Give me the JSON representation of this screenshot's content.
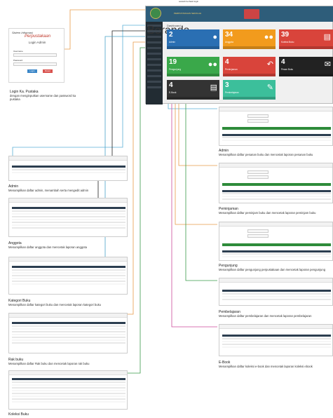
{
  "header_note": "setelah berhasil login",
  "login": {
    "brand_line1": "Sistem Informasi",
    "brand_line2": "Perpustakaan",
    "title": "Login Admin",
    "username_label": "Username",
    "password_label": "Password",
    "login_button": "Login",
    "reset_button": "Reset",
    "caption_title": "Login Ka. Pustaka",
    "caption_desc": "dengan menginputkan username dan password ka pustaka"
  },
  "dashboard": {
    "heading": "Dashboard",
    "app_title": "PERPUSTAKAAN SEKOLAH",
    "side_items": [
      "Beranda",
      "Admin",
      "Anggota",
      "Kategori Buku",
      "Rak Buku",
      "Koleksi Buku",
      "Eksemplar",
      "E-Book",
      "Peminjaman",
      "Pengunjung",
      "Pemesanan",
      "Pembelajaran"
    ],
    "tiles": [
      {
        "value": "2",
        "label": "Admin",
        "color": "#2a6fb3",
        "icon": "user-icon"
      },
      {
        "value": "34",
        "label": "Anggota",
        "color": "#f29b1d",
        "icon": "users-icon"
      },
      {
        "value": "39",
        "label": "Koleksi Buku",
        "color": "#d9443b",
        "icon": "book-icon"
      },
      {
        "value": "19",
        "label": "Pengunjung",
        "color": "#3aa84a",
        "icon": "group-icon"
      },
      {
        "value": "4",
        "label": "Peminjaman",
        "color": "#d9443b",
        "icon": "reply-icon"
      },
      {
        "value": "4",
        "label": "Pesan Buku",
        "color": "#222222",
        "icon": "mail-icon"
      },
      {
        "value": "4",
        "label": "E-Book",
        "color": "#333333",
        "icon": "pdf-icon"
      },
      {
        "value": "3",
        "label": "Pembelajaran",
        "color": "#3cbf9b",
        "icon": "pencil-icon"
      }
    ]
  },
  "captions": {
    "admin": {
      "title": "Admin",
      "desc": "Menampilkan daftar admin, menambah serta mengedit admin"
    },
    "anggota": {
      "title": "Anggota",
      "desc": "Menampilkan daftar anggota dan mencetak laporan anggota"
    },
    "kategori": {
      "title": "Kategori Buku",
      "desc": "Menampilkan daftar kategori buku dan mencetak laporan kategori buku"
    },
    "rak": {
      "title": "Rak buku",
      "desc": "Menampilkan daftar Rak buku dan mencetak laporan rak buku"
    },
    "koleksi": {
      "title": "Koleksi Buku",
      "desc": ""
    },
    "pesan": {
      "title": "Admin",
      "desc": "Menampilkan daftar pesanan buku dan mencetak laporan pesanan buku"
    },
    "pinjam": {
      "title": "Peminjaman",
      "desc": "Menampilkan daftar peminjam buku dan mencetak laporan peminjam buku"
    },
    "pengunjung": {
      "title": "Pengunjung",
      "desc": "Menampilkan daftar pengunjung perpustakaan dan mencetak laporan pengunjung"
    },
    "belajar": {
      "title": "Pembelajaran",
      "desc": "Menampilkan daftar pembelajaran dan mencetak laporan pembelajaran"
    },
    "ebook": {
      "title": "E-Book",
      "desc": "Menampilkan daftar koleksi e-book dan mencetak laporan koleksi ebook"
    }
  }
}
